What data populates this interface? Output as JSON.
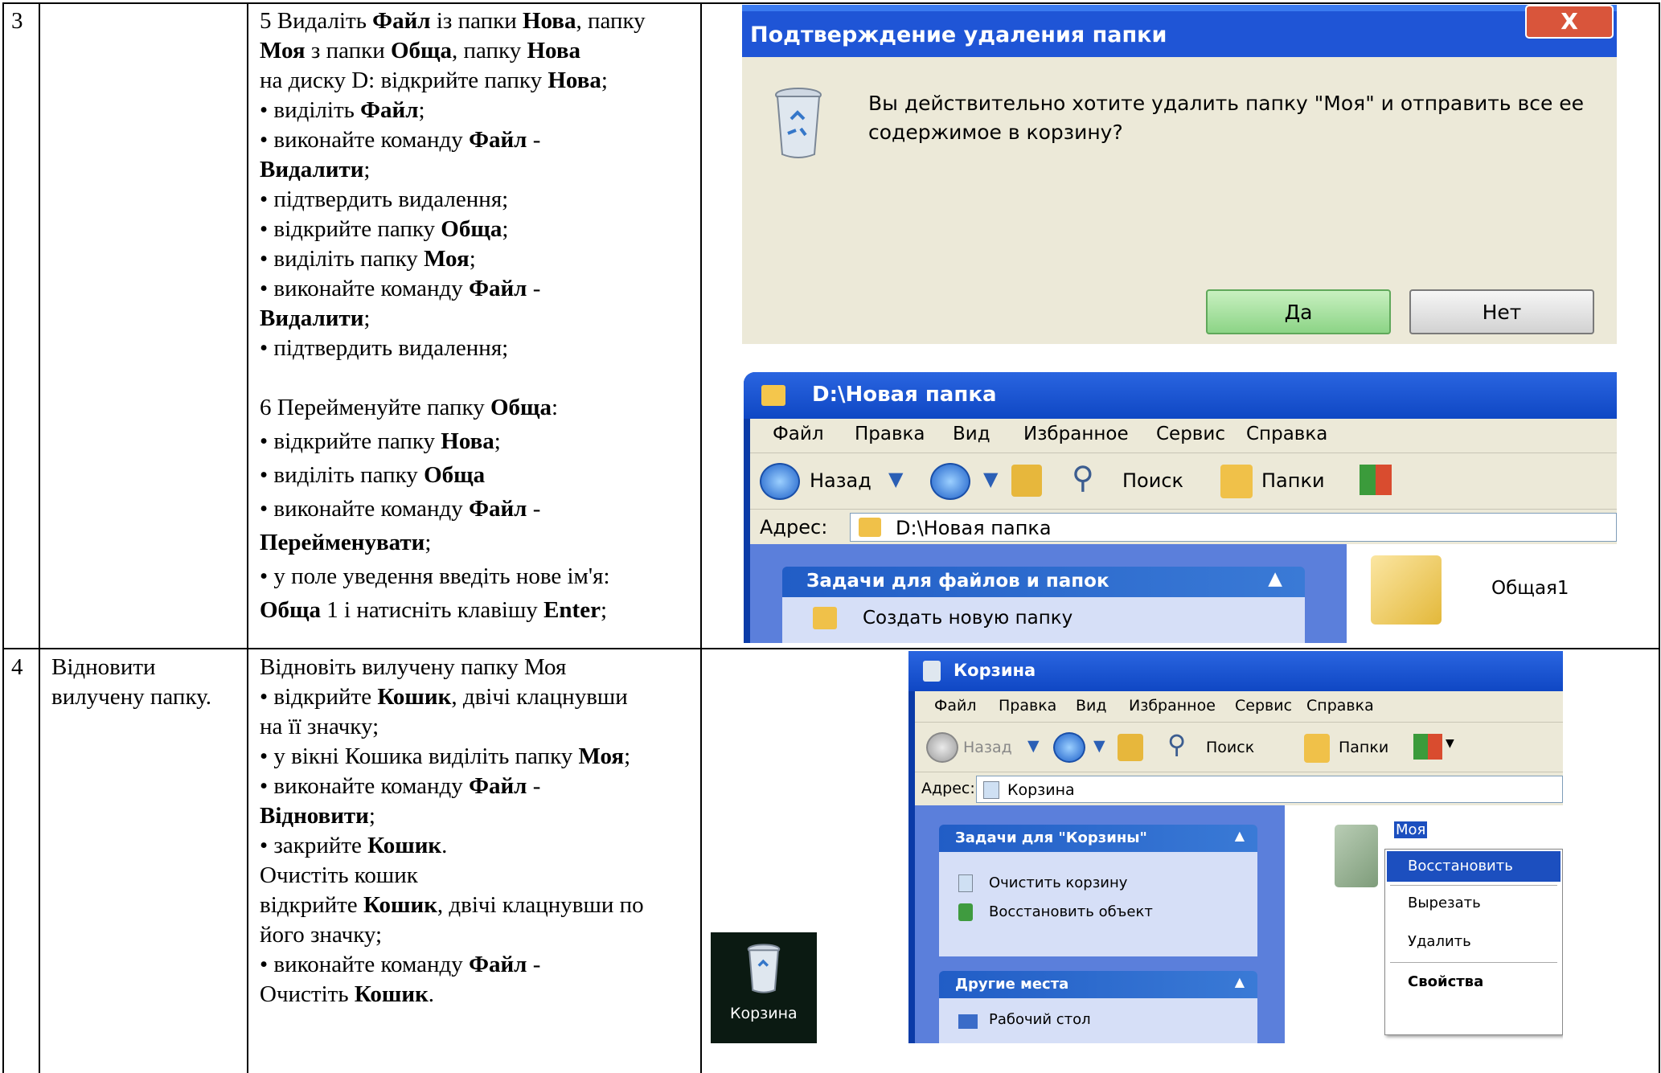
{
  "table": {
    "row3": {
      "num": "3",
      "step5": {
        "lines": [
          [
            "5 Видаліть ",
            "Файл",
            " із папки ",
            "Нова",
            ", папку"
          ],
          [
            "",
            "Моя",
            " з папки ",
            "Обща",
            ", папку ",
            "Нова"
          ],
          [
            "на диску D: відкрийте папку ",
            "Нова",
            ";"
          ],
          [
            "•  виділіть ",
            "Файл",
            ";"
          ],
          [
            "•  виконайте команду ",
            "Файл",
            " -"
          ],
          [
            "",
            "Видалити",
            ";"
          ],
          [
            "•  підтвердить видалення;"
          ],
          [
            "•  відкрийте папку ",
            "Обща",
            ";"
          ],
          [
            "•  виділіть папку ",
            "Моя",
            ";"
          ],
          [
            "•  виконайте команду ",
            "Файл",
            " -"
          ],
          [
            "",
            "Видалити",
            ";"
          ],
          [
            "•  підтвердить видалення;"
          ]
        ]
      },
      "step6": {
        "lines": [
          [
            "6 Перейменуйте папку ",
            "Обща",
            ":"
          ],
          [
            "• відкрийте папку ",
            "Нова",
            ";"
          ],
          [
            "• виділіть папку ",
            "Обща"
          ],
          [
            "• виконайте команду ",
            "Файл",
            " -"
          ],
          [
            "",
            "Перейменувати",
            ";"
          ],
          [
            "• у поле уведення введіть нове ім'я:"
          ],
          [
            "",
            "Обща",
            " 1 і натисніть клавішу ",
            "Enter",
            ";"
          ]
        ]
      }
    },
    "row4": {
      "num": "4",
      "task": "Відновити вилучену папку.",
      "lines": [
        [
          "Відновіть вилучену папку Моя"
        ],
        [
          "• відкрийте ",
          "Кошик",
          ", двічі клацнувши"
        ],
        [
          "на її значку;"
        ],
        [
          "• у вікні Кошика виділіть папку ",
          "Моя",
          ";"
        ],
        [
          "•  виконайте команду ",
          "Файл",
          " -"
        ],
        [
          "",
          "Відновити",
          ";"
        ],
        [
          "• закрийте ",
          "Кошик",
          "."
        ],
        [
          " Очистіть кошик"
        ],
        [
          "відкрийте ",
          "Кошик",
          ", двічі клацнувши по"
        ],
        [
          "його значку;"
        ],
        [
          "•  виконайте команду ",
          "Файл",
          " -"
        ],
        [
          "Очистіть ",
          "Кошик",
          "."
        ]
      ]
    }
  },
  "dialog": {
    "title": "Подтверждение удаления папки",
    "close": "X",
    "message_line1": "Вы действительно хотите удалить папку \"Моя\" и отправить все ее",
    "message_line2": "содержимое в корзину?",
    "yes": "Да",
    "no": "Нет"
  },
  "explorer1": {
    "title": "D:\\Новая папка",
    "menu": [
      "Файл",
      "Правка",
      "Вид",
      "Избранное",
      "Сервис",
      "Справка"
    ],
    "back": "Назад",
    "search": "Поиск",
    "folders": "Папки",
    "address_label": "Адрес:",
    "address": "D:\\Новая папка",
    "task_panel": "Задачи для файлов и папок",
    "task_item": "Создать новую папку",
    "folder_name": "Общая1"
  },
  "desktop_icon": {
    "label": "Корзина"
  },
  "explorer2": {
    "title": "Корзина",
    "menu": [
      "Файл",
      "Правка",
      "Вид",
      "Избранное",
      "Сервис",
      "Справка"
    ],
    "back": "Назад",
    "search": "Поиск",
    "folders": "Папки",
    "address_label": "Адрес:",
    "address": "Корзина",
    "task_panel": "Задачи для \"Корзины\"",
    "tasks": [
      "Очистить корзину",
      "Восстановить объект"
    ],
    "other_panel": "Другие места",
    "other_item": "Рабочий стол",
    "folder_name": "Моя",
    "context_menu": [
      "Восстановить",
      "Вырезать",
      "Удалить",
      "Свойства"
    ]
  }
}
